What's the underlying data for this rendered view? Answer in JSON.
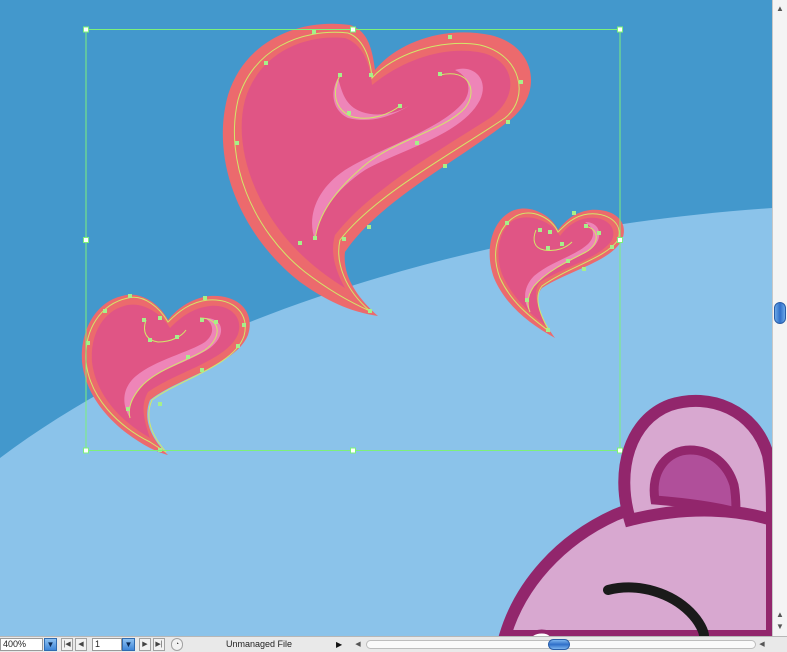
{
  "statusbar": {
    "zoom_value": "400%",
    "page_value": "1",
    "file_status": "Unmanaged File"
  },
  "icons": {
    "zoom_dropdown": "chevron-down-icon",
    "first_page": "first-page-icon",
    "prev_page": "previous-page-icon",
    "next_page": "next-page-icon",
    "last_page": "last-page-icon",
    "status_menu": "play-icon"
  },
  "colors": {
    "sky_dark": "#4398cc",
    "sky_light": "#8bc3ea",
    "heart_outer": "#ec6a6d",
    "heart_fill": "#e05585",
    "heart_highlight": "#ee85b8",
    "selection": "#7df07a",
    "bear_outline": "#92266c",
    "bear_fill": "#d8a8d0",
    "bear_ear_inner": "#b04f9a"
  }
}
